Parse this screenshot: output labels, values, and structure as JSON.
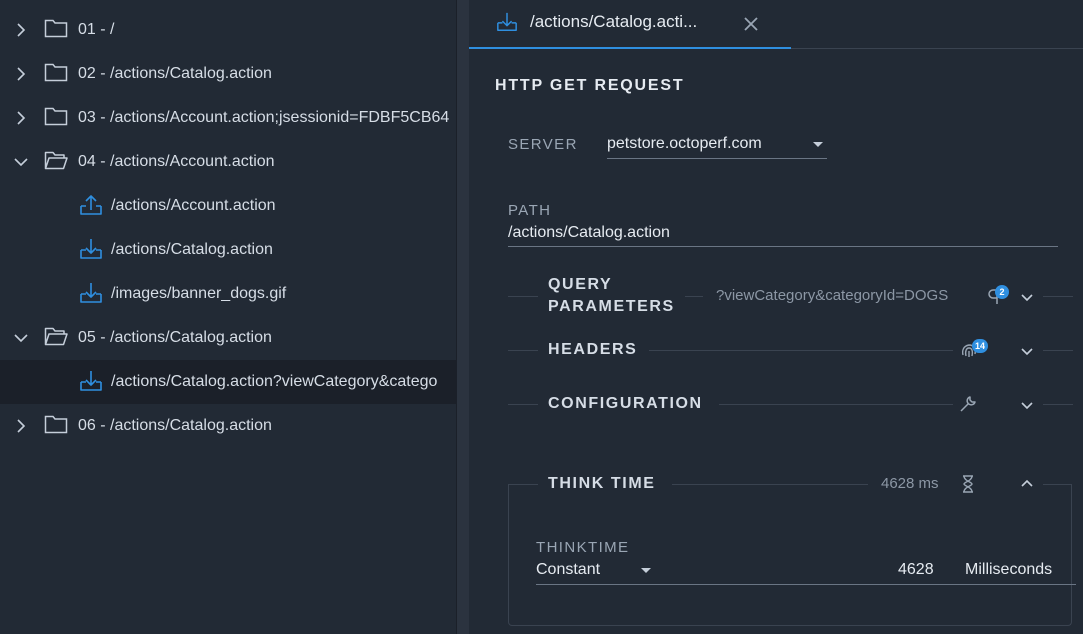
{
  "tree": {
    "items": [
      {
        "label": "01 - /",
        "expanded": false,
        "kind": "folder"
      },
      {
        "label": "02 - /actions/Catalog.action",
        "expanded": false,
        "kind": "folder"
      },
      {
        "label": "03 - /actions/Account.action;jsessionid=FDBF5CB64",
        "expanded": false,
        "kind": "folder"
      },
      {
        "label": "04 - /actions/Account.action",
        "expanded": true,
        "kind": "folder"
      },
      {
        "label": "/actions/Account.action",
        "kind": "upload"
      },
      {
        "label": "/actions/Catalog.action",
        "kind": "download"
      },
      {
        "label": "/images/banner_dogs.gif",
        "kind": "download"
      },
      {
        "label": "05 - /actions/Catalog.action",
        "expanded": true,
        "kind": "folder"
      },
      {
        "label": "/actions/Catalog.action?viewCategory&catego",
        "kind": "download",
        "selected": true
      },
      {
        "label": "06 - /actions/Catalog.action",
        "expanded": false,
        "kind": "folder"
      }
    ]
  },
  "tab": {
    "label": "/actions/Catalog.acti...",
    "icon": "download-icon",
    "close_icon": "close-icon"
  },
  "request": {
    "title": "HTTP GET REQUEST",
    "server_label": "SERVER",
    "server_value": "petstore.octoperf.com",
    "path_label": "PATH",
    "path_value": "/actions/Catalog.action"
  },
  "sections": {
    "query": {
      "title_line1": "QUERY",
      "title_line2": "PARAMETERS",
      "summary": "?viewCategory&categoryId=DOGS",
      "badge": "2"
    },
    "headers": {
      "title": "HEADERS",
      "badge": "14"
    },
    "configuration": {
      "title": "CONFIGURATION"
    },
    "think_time": {
      "title": "THINK TIME",
      "summary": "4628 ms"
    }
  },
  "thinktime": {
    "label": "THINKTIME",
    "mode": "Constant",
    "value": "4628",
    "unit": "Milliseconds"
  },
  "colors": {
    "accent": "#2f8fe0",
    "background": "#222a35",
    "selected_row": "#1b2029"
  }
}
